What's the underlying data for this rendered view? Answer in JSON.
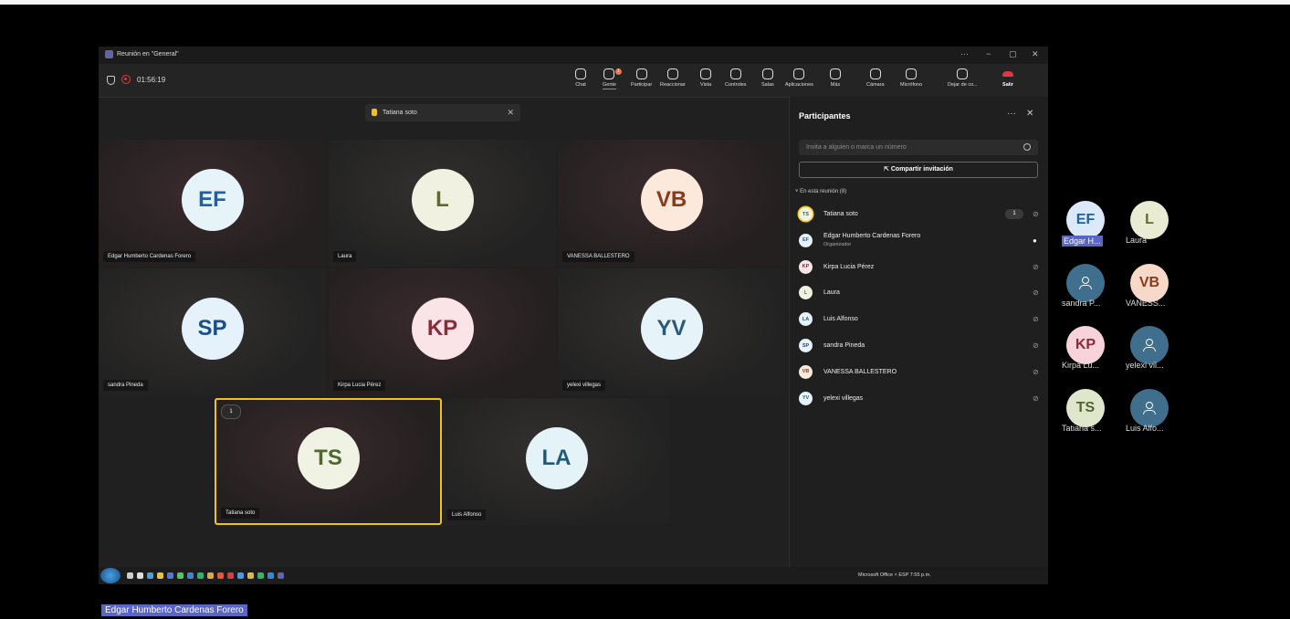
{
  "window": {
    "title": "Reunión en \"General\"",
    "timer": "01:56:19",
    "controls": [
      "···",
      "−",
      "▢",
      "✕"
    ]
  },
  "toolbar": {
    "buttons": [
      {
        "label": "Chat",
        "icon": "chat-icon"
      },
      {
        "label": "Gente",
        "icon": "people-icon",
        "badge": "1"
      },
      {
        "label": "Participar",
        "icon": "raise-hand-icon"
      },
      {
        "label": "Reaccionar",
        "icon": "smiley-icon"
      },
      {
        "label": "Vista",
        "icon": "grid-view-icon"
      },
      {
        "label": "Controles",
        "icon": "controls-icon"
      },
      {
        "label": "Salas",
        "icon": "rooms-icon"
      },
      {
        "label": "Aplicaciones",
        "icon": "apps-icon"
      },
      {
        "label": "Más",
        "icon": "more-icon"
      },
      {
        "label": "Cámara",
        "icon": "camera-off-icon"
      },
      {
        "label": "Micrófono",
        "icon": "microphone-icon"
      },
      {
        "label": "Dejar de co...",
        "icon": "stop-share-icon"
      }
    ],
    "leave_label": "Salir"
  },
  "toast": {
    "name": "Tatiana soto"
  },
  "tiles": [
    {
      "initials": "EF",
      "name": "Edgar Humberto Cardenas Forero",
      "bg": "#e6f4fa",
      "fg": "#1f5ea8"
    },
    {
      "initials": "L",
      "name": "Laura",
      "bg": "#f0f1e0",
      "fg": "#5f6b2a"
    },
    {
      "initials": "VB",
      "name": "VANESSA BALLESTERO",
      "bg": "#fde8dc",
      "fg": "#8a3a1a"
    },
    {
      "initials": "SP",
      "name": "sandra Pineda",
      "bg": "#e6f2fb",
      "fg": "#1a4e8a"
    },
    {
      "initials": "KP",
      "name": "Kirpa Lucia Pérez",
      "bg": "#fbe4e8",
      "fg": "#8b2a3a"
    },
    {
      "initials": "YV",
      "name": "yelexi villegas",
      "bg": "#e6f3f8",
      "fg": "#2a5a7a"
    },
    {
      "initials": "TS",
      "name": "Tatiana soto",
      "bg": "#f0f2e4",
      "fg": "#4f6630",
      "hand": "1"
    },
    {
      "initials": "LA",
      "name": "Luis Alfonso",
      "bg": "#e4f3f8",
      "fg": "#1f5a7a"
    }
  ],
  "panel": {
    "title": "Participantes",
    "invite_placeholder": "Invita a alguien o marca un número",
    "share_label": "Compartir invitación",
    "section": "En esta reunión (8)",
    "people": [
      {
        "initials": "TS",
        "name": "Tatiana soto",
        "bg": "#f0f2e4",
        "fg": "#4f6630",
        "hand": "1"
      },
      {
        "initials": "EF",
        "name": "Edgar Humberto Cardenas Forero",
        "bg": "#e6f4fa",
        "fg": "#1f5ea8",
        "role": "Organizador",
        "mic_on": true
      },
      {
        "initials": "KP",
        "name": "Kirpa Lucia Pérez",
        "bg": "#fbe4e8",
        "fg": "#8b2a3a"
      },
      {
        "initials": "L",
        "name": "Laura",
        "bg": "#f0f1e0",
        "fg": "#5f6b2a"
      },
      {
        "initials": "LA",
        "name": "Luis Alfonso",
        "bg": "#e4f3f8",
        "fg": "#1f5a7a"
      },
      {
        "initials": "SP",
        "name": "sandra Pineda",
        "bg": "#e6f2fb",
        "fg": "#1a4e8a"
      },
      {
        "initials": "VB",
        "name": "VANESSA BALLESTERO",
        "bg": "#fde8dc",
        "fg": "#8a3a1a"
      },
      {
        "initials": "YV",
        "name": "yelexi villegas",
        "bg": "#e6f3f8",
        "fg": "#2a5a7a"
      }
    ]
  },
  "taskbar": {
    "tray_text": "Microsoft Office  ˄  ESP  7:55 p.m."
  },
  "floating": [
    {
      "initials": "EF",
      "label": "Edgar H...",
      "bg": "#dbe9f8",
      "fg": "#1f5ea8",
      "highlight": true
    },
    {
      "initials": "L",
      "label": "Laura",
      "bg": "#e9ecd2",
      "fg": "#5f6b2a"
    },
    {
      "initials": "",
      "label": "sandra P...",
      "bg": "#3f6f8c",
      "fg": "#fff",
      "icon": "person-icon"
    },
    {
      "initials": "VB",
      "label": "VANESS...",
      "bg": "#f8d8c8",
      "fg": "#8a3a1a"
    },
    {
      "initials": "KP",
      "label": "Kirpa Lu...",
      "bg": "#f8d4da",
      "fg": "#8b2a3a"
    },
    {
      "initials": "",
      "label": "yelexi vil...",
      "bg": "#3f6f8c",
      "fg": "#fff",
      "icon": "person-icon"
    },
    {
      "initials": "TS",
      "label": "Tatiana s...",
      "bg": "#dfe6cc",
      "fg": "#4f6630"
    },
    {
      "initials": "",
      "label": "Luis Alfo...",
      "bg": "#3f6f8c",
      "fg": "#fff",
      "icon": "person-icon"
    }
  ],
  "bottom_label": "Edgar Humberto Cardenas Forero"
}
